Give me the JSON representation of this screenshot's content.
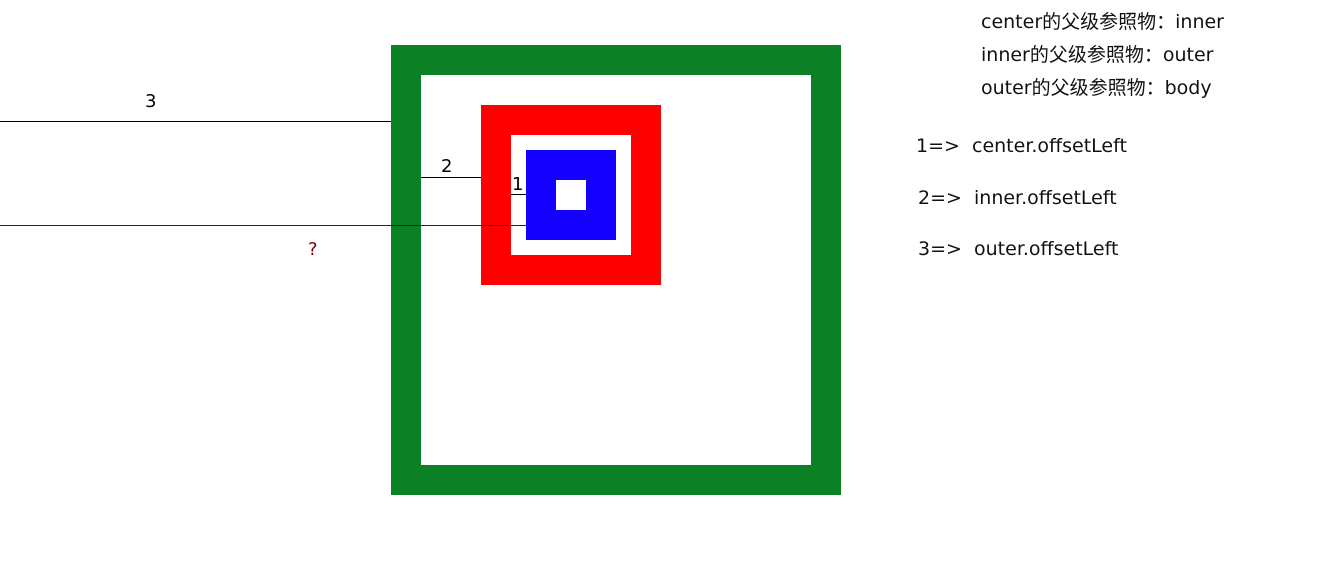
{
  "diagram": {
    "boxes": {
      "outer": {
        "name": "outer",
        "border_color": "#0b8024"
      },
      "inner": {
        "name": "inner",
        "border_color": "#ff0000"
      },
      "center": {
        "name": "center",
        "border_color": "#1400ff"
      }
    },
    "markers": {
      "label_1": "1",
      "label_2": "2",
      "label_3": "3",
      "label_question": "?"
    }
  },
  "notes": {
    "parents": [
      "center的父级参照物：inner",
      "inner的父级参照物：outer",
      "outer的父级参照物：body"
    ],
    "offsets": [
      "1=>  center.offsetLeft",
      "2=>  inner.offsetLeft",
      "3=>  outer.offsetLeft"
    ]
  }
}
